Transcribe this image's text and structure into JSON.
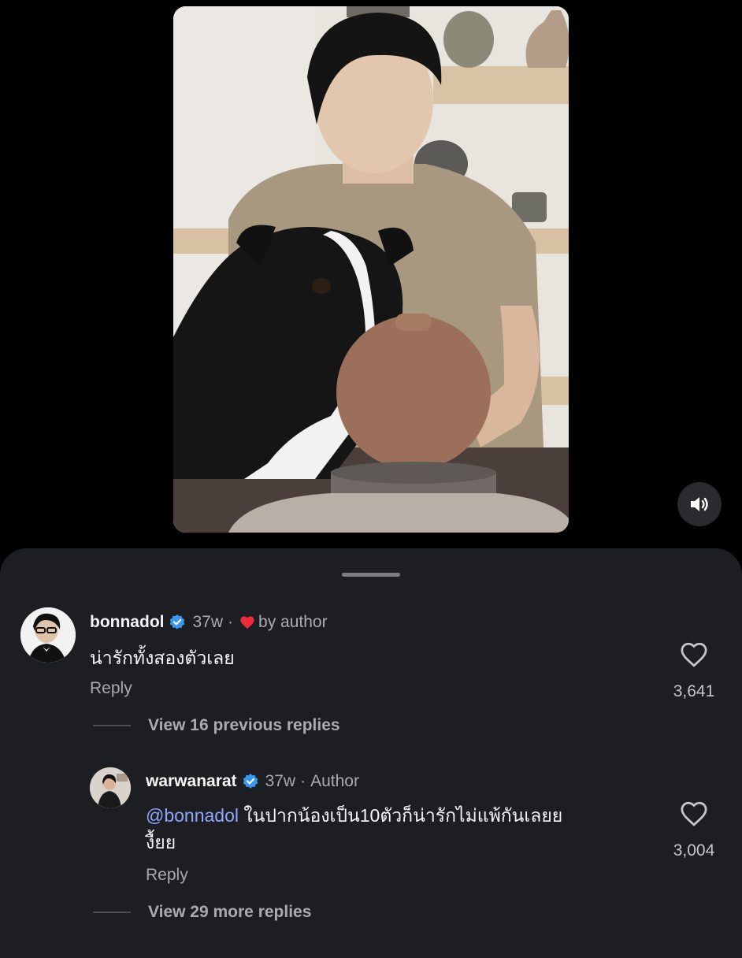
{
  "video": {
    "mute_icon": "speaker-icon"
  },
  "comments": [
    {
      "username": "bonnadol",
      "time": "37w",
      "separator": "·",
      "badge": "by author",
      "text": "น่ารักทั้งสองตัวเลย",
      "reply_label": "Reply",
      "like_count": "3,641",
      "view_replies": "View 16 previous replies"
    },
    {
      "username": "warwanarat",
      "time": "37w",
      "separator": "·",
      "badge": "Author",
      "mention": "@bonnadol",
      "text_line1": "ในปากน้องเป็น10ตัวก็น่ารักไม่แพ้กันเลยย",
      "text_line2": "งื้ยย",
      "reply_label": "Reply",
      "like_count": "3,004",
      "view_replies": "View 29 more replies"
    }
  ],
  "colors": {
    "sheet_bg": "#1c1e22",
    "verified_blue": "#3897f0",
    "heart_red": "#ed2b3c",
    "mention_blue": "#8fa7ff"
  }
}
